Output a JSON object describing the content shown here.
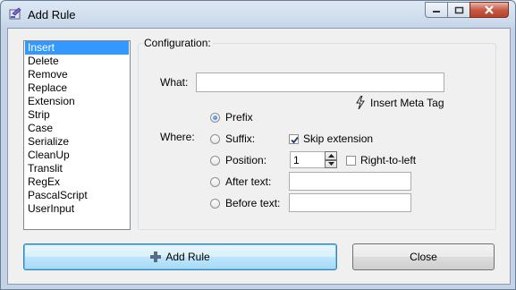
{
  "window": {
    "title": "Add Rule",
    "icon": "app-icon"
  },
  "rules_list": {
    "items": [
      "Insert",
      "Delete",
      "Remove",
      "Replace",
      "Extension",
      "Strip",
      "Case",
      "Serialize",
      "CleanUp",
      "Translit",
      "RegEx",
      "PascalScript",
      "UserInput"
    ],
    "selected": "Insert"
  },
  "config": {
    "group_label": "Configuration:",
    "what_label": "What:",
    "what_value": "",
    "meta_tag_label": "Insert Meta Tag",
    "where_label": "Where:",
    "options": {
      "prefix": "Prefix",
      "suffix": "Suffix:",
      "position": "Position:",
      "after_text": "After text:",
      "before_text": "Before text:"
    },
    "selected_option": "Prefix",
    "skip_extension_label": "Skip extension",
    "skip_extension_checked": true,
    "position_value": "1",
    "right_to_left_label": "Right-to-left",
    "right_to_left_checked": false,
    "after_text_value": "",
    "before_text_value": ""
  },
  "buttons": {
    "add_rule": "Add Rule",
    "close": "Close"
  }
}
